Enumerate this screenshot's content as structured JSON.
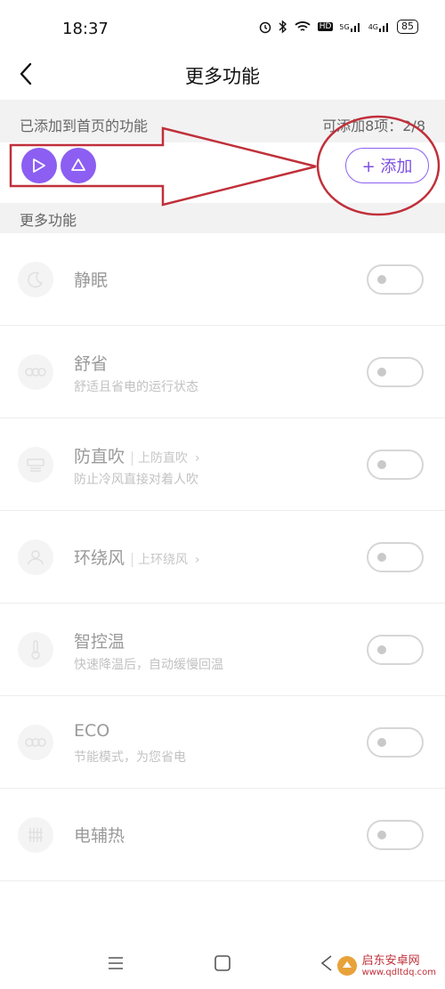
{
  "status_bar": {
    "time": "18:37",
    "network_5g": "5G",
    "network_4g": "4G",
    "hd_badge": "HD",
    "battery": "85"
  },
  "header": {
    "title": "更多功能"
  },
  "added_section": {
    "label": "已添加到首页的功能",
    "count": "可添加8项：2/8",
    "add_button_label": "+ 添加",
    "chips": [
      "chip-icon-a",
      "chip-icon-b"
    ]
  },
  "more_section": {
    "label": "更多功能"
  },
  "features": [
    {
      "title": "静眠",
      "subtitle": "",
      "link": "",
      "icon": "sleep-icon",
      "enabled": false
    },
    {
      "title": "舒省",
      "subtitle": "舒适且省电的运行状态",
      "link": "",
      "icon": "eco-icon",
      "enabled": false
    },
    {
      "title": "防直吹",
      "subtitle": "防止冷风直接对着人吹",
      "link": "上防直吹",
      "icon": "air-deflect-icon",
      "enabled": false
    },
    {
      "title": "环绕风",
      "subtitle": "",
      "link": "上环绕风",
      "icon": "surround-wind-icon",
      "enabled": false
    },
    {
      "title": "智控温",
      "subtitle": "快速降温后，自动缓慢回温",
      "link": "",
      "icon": "thermometer-icon",
      "enabled": false
    },
    {
      "title": "ECO",
      "subtitle": "节能模式，为您省电",
      "link": "",
      "icon": "eco-mode-icon",
      "enabled": false
    },
    {
      "title": "电辅热",
      "subtitle": "",
      "link": "",
      "icon": "heater-icon",
      "enabled": false
    }
  ],
  "watermark": {
    "name": "启东安卓网",
    "url": "www.qdltdq.com"
  },
  "colors": {
    "accent": "#8c5ef2",
    "annotation": "#c0303a"
  }
}
